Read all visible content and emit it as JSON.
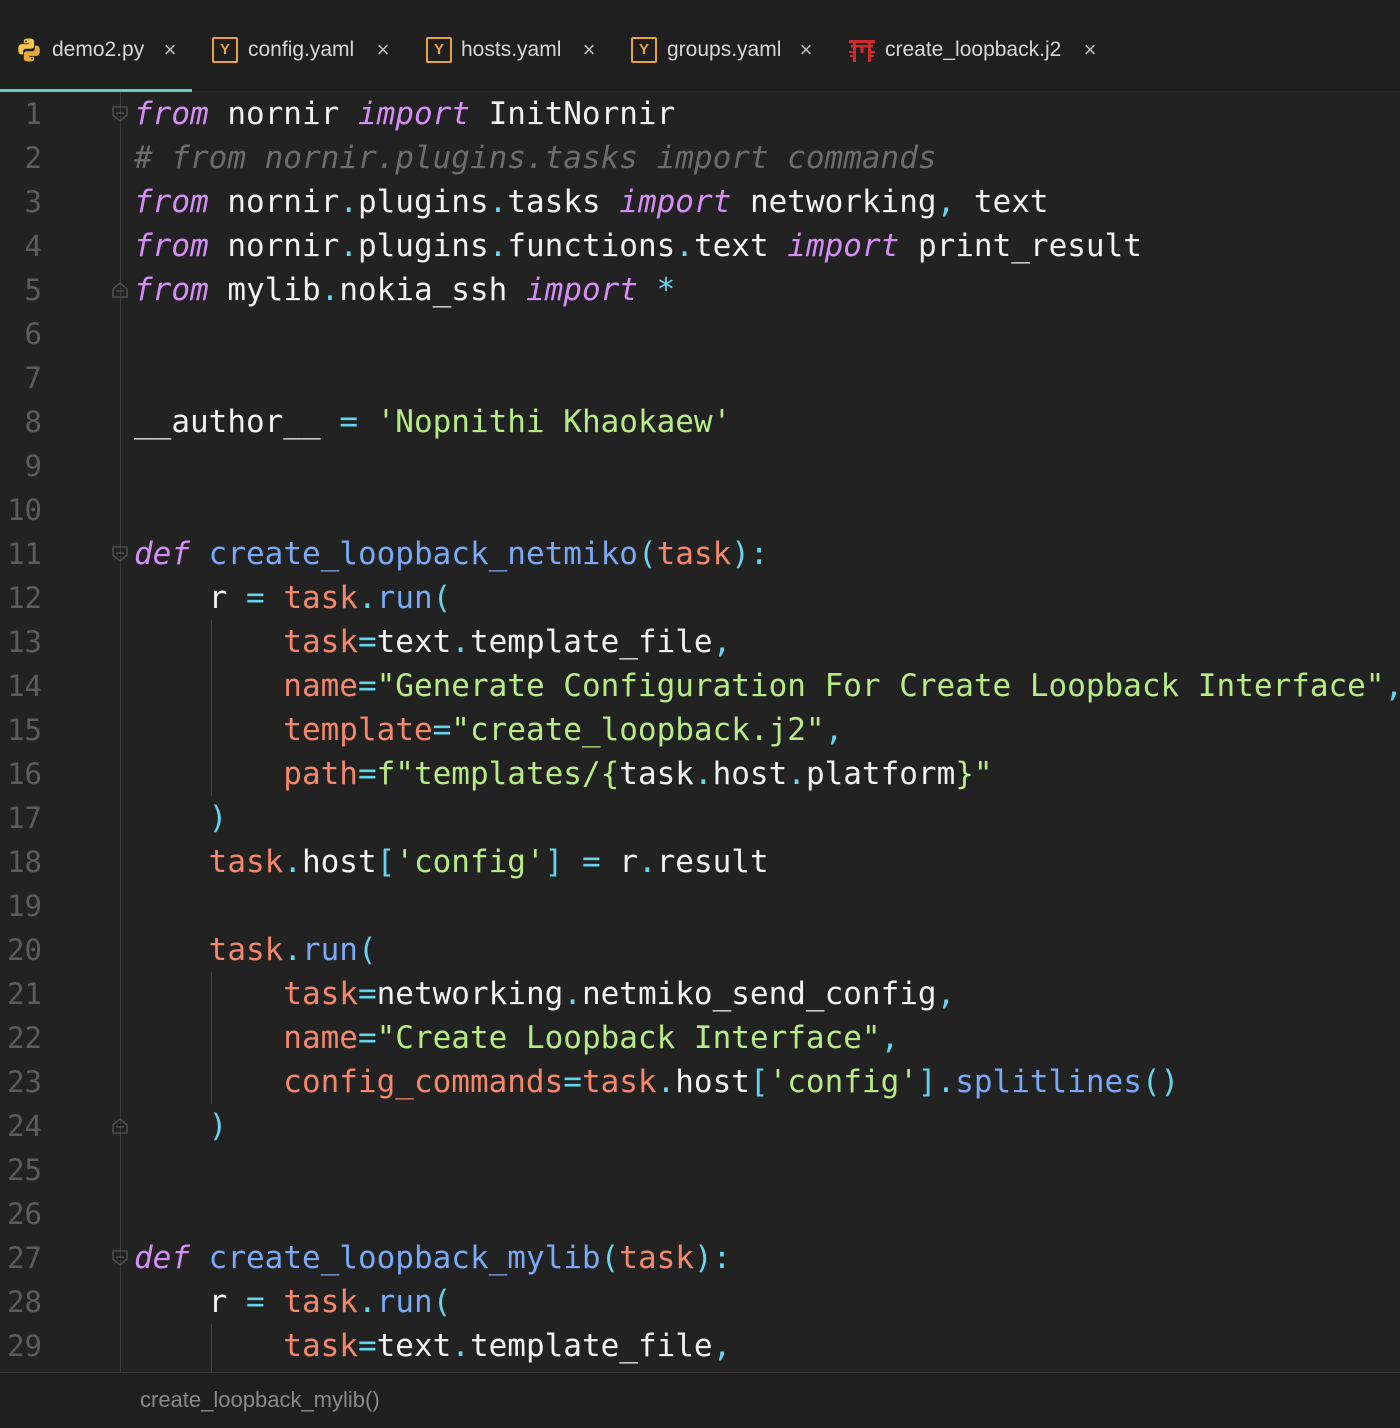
{
  "tabs": [
    {
      "label": "demo2.py",
      "icon": "python-icon",
      "active": true
    },
    {
      "label": "config.yaml",
      "icon": "yaml-icon",
      "icon_text": "Y",
      "active": false
    },
    {
      "label": "hosts.yaml",
      "icon": "yaml-icon",
      "icon_text": "Y",
      "active": false
    },
    {
      "label": "groups.yaml",
      "icon": "yaml-icon",
      "icon_text": "Y",
      "active": false
    },
    {
      "label": "create_loopback.j2",
      "icon": "jinja-icon",
      "active": false
    }
  ],
  "close_glyph": "×",
  "colors": {
    "accent": "#5fcfbf",
    "keyword": "#d58ef5",
    "string": "#b7ec85",
    "function": "#7aa9f5",
    "operator": "#67d4ee",
    "parameter": "#f5876a",
    "comment": "#6c6c6c",
    "background": "#222222"
  },
  "editor": {
    "lines": [
      {
        "n": "1",
        "tokens": [
          [
            "kw",
            "from"
          ],
          [
            "id",
            " nornir "
          ],
          [
            "kw",
            "import"
          ],
          [
            "id",
            " InitNornir"
          ]
        ]
      },
      {
        "n": "2",
        "tokens": [
          [
            "com",
            "# from nornir.plugins.tasks import commands"
          ]
        ]
      },
      {
        "n": "3",
        "tokens": [
          [
            "kw",
            "from"
          ],
          [
            "id",
            " nornir"
          ],
          [
            "op",
            "."
          ],
          [
            "id",
            "plugins"
          ],
          [
            "op",
            "."
          ],
          [
            "id",
            "tasks "
          ],
          [
            "kw",
            "import"
          ],
          [
            "id",
            " networking"
          ],
          [
            "op",
            ","
          ],
          [
            "id",
            " text"
          ]
        ]
      },
      {
        "n": "4",
        "tokens": [
          [
            "kw",
            "from"
          ],
          [
            "id",
            " nornir"
          ],
          [
            "op",
            "."
          ],
          [
            "id",
            "plugins"
          ],
          [
            "op",
            "."
          ],
          [
            "id",
            "functions"
          ],
          [
            "op",
            "."
          ],
          [
            "id",
            "text "
          ],
          [
            "kw",
            "import"
          ],
          [
            "id",
            " print_result"
          ]
        ]
      },
      {
        "n": "5",
        "tokens": [
          [
            "kw",
            "from"
          ],
          [
            "id",
            " mylib"
          ],
          [
            "op",
            "."
          ],
          [
            "id",
            "nokia_ssh "
          ],
          [
            "kw",
            "import"
          ],
          [
            "op",
            " *"
          ]
        ]
      },
      {
        "n": "6",
        "tokens": []
      },
      {
        "n": "7",
        "tokens": []
      },
      {
        "n": "8",
        "tokens": [
          [
            "id",
            "__author__ "
          ],
          [
            "op",
            "="
          ],
          [
            "str",
            " 'Nopnithi Khaokaew'"
          ]
        ]
      },
      {
        "n": "9",
        "tokens": []
      },
      {
        "n": "10",
        "tokens": []
      },
      {
        "n": "11",
        "tokens": [
          [
            "kw",
            "def"
          ],
          [
            "fn",
            " create_loopback_netmiko"
          ],
          [
            "op",
            "("
          ],
          [
            "par",
            "task"
          ],
          [
            "op",
            "):"
          ]
        ]
      },
      {
        "n": "12",
        "tokens": [
          [
            "id",
            "    r "
          ],
          [
            "op",
            "="
          ],
          [
            "par",
            " task"
          ],
          [
            "op",
            "."
          ],
          [
            "fn",
            "run"
          ],
          [
            "op",
            "("
          ]
        ]
      },
      {
        "n": "13",
        "tokens": [
          [
            "arg",
            "        task"
          ],
          [
            "op",
            "="
          ],
          [
            "id",
            "text"
          ],
          [
            "op",
            "."
          ],
          [
            "id",
            "template_file"
          ],
          [
            "op",
            ","
          ]
        ]
      },
      {
        "n": "14",
        "tokens": [
          [
            "arg",
            "        name"
          ],
          [
            "op",
            "="
          ],
          [
            "str",
            "\"Generate Configuration For Create Loopback Interface\""
          ],
          [
            "op",
            ","
          ]
        ]
      },
      {
        "n": "15",
        "tokens": [
          [
            "arg",
            "        template"
          ],
          [
            "op",
            "="
          ],
          [
            "str",
            "\"create_loopback.j2\""
          ],
          [
            "op",
            ","
          ]
        ]
      },
      {
        "n": "16",
        "tokens": [
          [
            "arg",
            "        path"
          ],
          [
            "op",
            "="
          ],
          [
            "str",
            "f\"templates/{"
          ],
          [
            "id",
            "task"
          ],
          [
            "op",
            "."
          ],
          [
            "id",
            "host"
          ],
          [
            "op",
            "."
          ],
          [
            "id",
            "platform"
          ],
          [
            "str",
            "}\""
          ]
        ]
      },
      {
        "n": "17",
        "tokens": [
          [
            "op",
            "    )"
          ]
        ]
      },
      {
        "n": "18",
        "tokens": [
          [
            "par",
            "    task"
          ],
          [
            "op",
            "."
          ],
          [
            "id",
            "host"
          ],
          [
            "op",
            "["
          ],
          [
            "str",
            "'config'"
          ],
          [
            "op",
            "]"
          ],
          [
            "op",
            " ="
          ],
          [
            "id",
            " r"
          ],
          [
            "op",
            "."
          ],
          [
            "id",
            "result"
          ]
        ]
      },
      {
        "n": "19",
        "tokens": []
      },
      {
        "n": "20",
        "tokens": [
          [
            "par",
            "    task"
          ],
          [
            "op",
            "."
          ],
          [
            "fn",
            "run"
          ],
          [
            "op",
            "("
          ]
        ]
      },
      {
        "n": "21",
        "tokens": [
          [
            "arg",
            "        task"
          ],
          [
            "op",
            "="
          ],
          [
            "id",
            "networking"
          ],
          [
            "op",
            "."
          ],
          [
            "id",
            "netmiko_send_config"
          ],
          [
            "op",
            ","
          ]
        ]
      },
      {
        "n": "22",
        "tokens": [
          [
            "arg",
            "        name"
          ],
          [
            "op",
            "="
          ],
          [
            "str",
            "\"Create Loopback Interface\""
          ],
          [
            "op",
            ","
          ]
        ]
      },
      {
        "n": "23",
        "tokens": [
          [
            "arg",
            "        config_commands"
          ],
          [
            "op",
            "="
          ],
          [
            "par",
            "task"
          ],
          [
            "op",
            "."
          ],
          [
            "id",
            "host"
          ],
          [
            "op",
            "["
          ],
          [
            "str",
            "'config'"
          ],
          [
            "op",
            "]."
          ],
          [
            "fn",
            "splitlines"
          ],
          [
            "op",
            "()"
          ]
        ]
      },
      {
        "n": "24",
        "tokens": [
          [
            "op",
            "    )"
          ]
        ]
      },
      {
        "n": "25",
        "tokens": []
      },
      {
        "n": "26",
        "tokens": []
      },
      {
        "n": "27",
        "tokens": [
          [
            "kw",
            "def"
          ],
          [
            "fn",
            " create_loopback_mylib"
          ],
          [
            "op",
            "("
          ],
          [
            "par",
            "task"
          ],
          [
            "op",
            "):"
          ]
        ]
      },
      {
        "n": "28",
        "tokens": [
          [
            "id",
            "    r "
          ],
          [
            "op",
            "="
          ],
          [
            "par",
            " task"
          ],
          [
            "op",
            "."
          ],
          [
            "fn",
            "run"
          ],
          [
            "op",
            "("
          ]
        ]
      },
      {
        "n": "29",
        "tokens": [
          [
            "arg",
            "        task"
          ],
          [
            "op",
            "="
          ],
          [
            "id",
            "text"
          ],
          [
            "op",
            "."
          ],
          [
            "id",
            "template_file"
          ],
          [
            "op",
            ","
          ]
        ]
      }
    ]
  },
  "statusbar": {
    "breadcrumb": "create_loopback_mylib()"
  }
}
